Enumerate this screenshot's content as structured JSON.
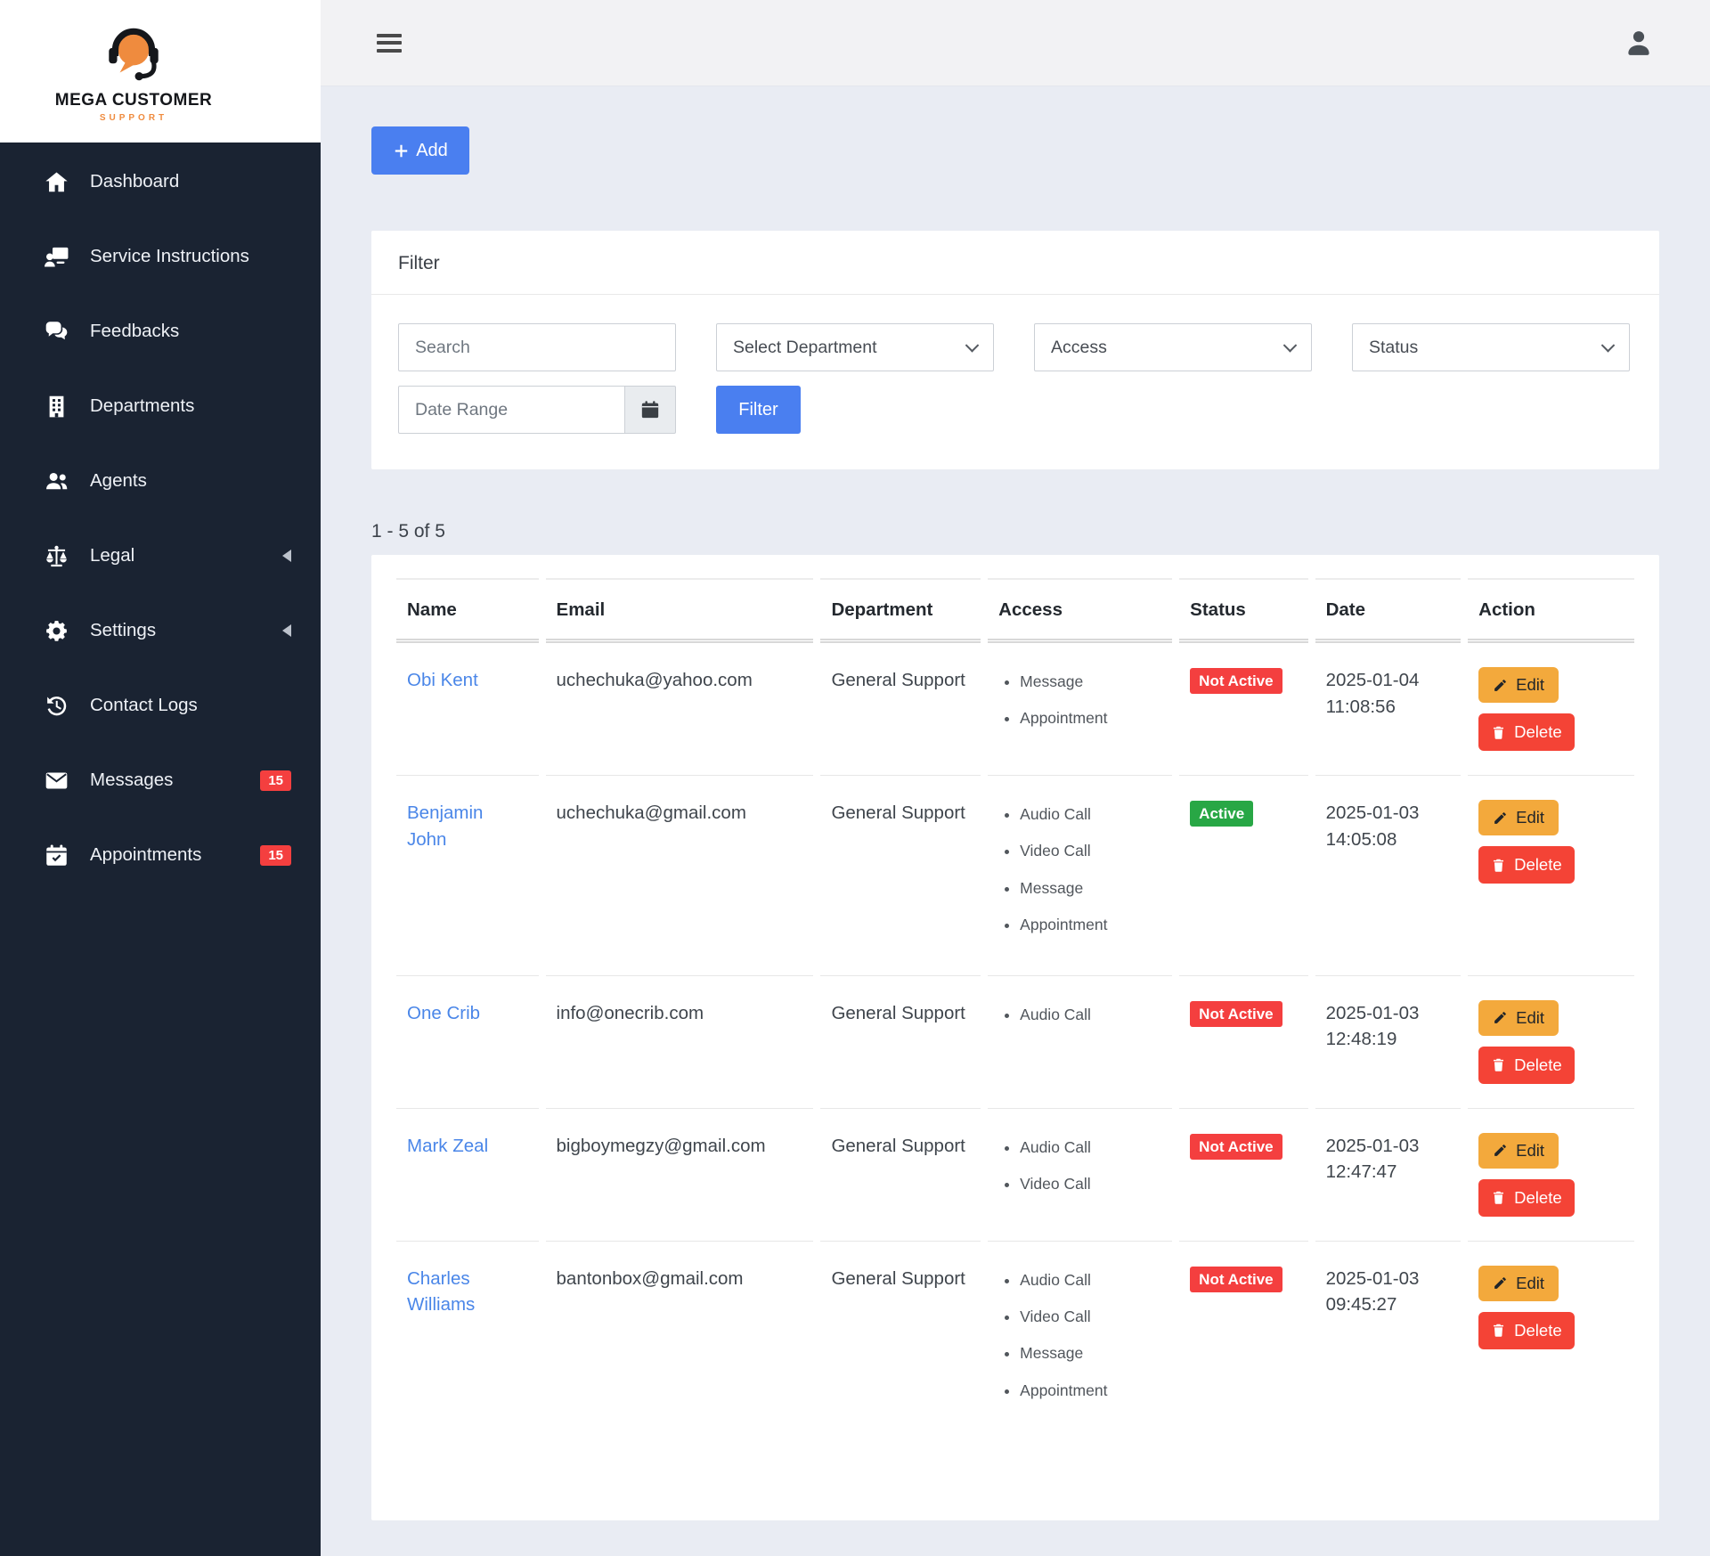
{
  "logo": {
    "line1": "MEGA CUSTOMER",
    "line2": "SUPPORT"
  },
  "sidebar": {
    "items": [
      {
        "label": "Dashboard",
        "icon": "home-icon"
      },
      {
        "label": "Service Instructions",
        "icon": "chalkboard-user-icon"
      },
      {
        "label": "Feedbacks",
        "icon": "comments-icon"
      },
      {
        "label": "Departments",
        "icon": "building-icon"
      },
      {
        "label": "Agents",
        "icon": "users-icon"
      },
      {
        "label": "Legal",
        "icon": "scales-icon",
        "caret": true
      },
      {
        "label": "Settings",
        "icon": "gear-icon",
        "caret": true
      },
      {
        "label": "Contact Logs",
        "icon": "history-icon"
      },
      {
        "label": "Messages",
        "icon": "envelope-icon",
        "badge": "15"
      },
      {
        "label": "Appointments",
        "icon": "calendar-check-icon",
        "badge": "15"
      }
    ]
  },
  "toolbar": {
    "add_label": "Add"
  },
  "filter": {
    "title": "Filter",
    "search_placeholder": "Search",
    "department_option": "Select Department",
    "access_option": "Access",
    "status_option": "Status",
    "date_placeholder": "Date Range",
    "submit_label": "Filter"
  },
  "table": {
    "summary": "1 - 5 of 5",
    "columns": [
      "Name",
      "Email",
      "Department",
      "Access",
      "Status",
      "Date",
      "Action"
    ],
    "edit_label": "Edit",
    "delete_label": "Delete",
    "rows": [
      {
        "name": "Obi Kent",
        "email": "uchechuka@yahoo.com",
        "department": "General Support",
        "access": [
          "Message",
          "Appointment"
        ],
        "status": "Not Active",
        "status_type": "inactive",
        "date": "2025-01-04",
        "time": "11:08:56"
      },
      {
        "name": "Benjamin John",
        "email": "uchechuka@gmail.com",
        "department": "General Support",
        "access": [
          "Audio Call",
          "Video Call",
          "Message",
          "Appointment"
        ],
        "status": "Active",
        "status_type": "active",
        "date": "2025-01-03",
        "time": "14:05:08"
      },
      {
        "name": "One Crib",
        "email": "info@onecrib.com",
        "department": "General Support",
        "access": [
          "Audio Call"
        ],
        "status": "Not Active",
        "status_type": "inactive",
        "date": "2025-01-03",
        "time": "12:48:19"
      },
      {
        "name": "Mark Zeal",
        "email": "bigboymegzy@gmail.com",
        "department": "General Support",
        "access": [
          "Audio Call",
          "Video Call"
        ],
        "status": "Not Active",
        "status_type": "inactive",
        "date": "2025-01-03",
        "time": "12:47:47"
      },
      {
        "name": "Charles Williams",
        "email": "bantonbox@gmail.com",
        "department": "General Support",
        "access": [
          "Audio Call",
          "Video Call",
          "Message",
          "Appointment"
        ],
        "status": "Not Active",
        "status_type": "inactive",
        "date": "2025-01-03",
        "time": "09:45:27"
      }
    ]
  },
  "colors": {
    "sidebar_bg": "#1a2332",
    "primary_blue": "#4a7ff0",
    "link_blue": "#4a86e8",
    "badge_red": "#f43f3f",
    "delete_red": "#f44336",
    "active_green": "#28a745",
    "edit_orange": "#f3a93c",
    "logo_orange": "#ef8b3e",
    "main_bg": "#e9ecf3"
  }
}
